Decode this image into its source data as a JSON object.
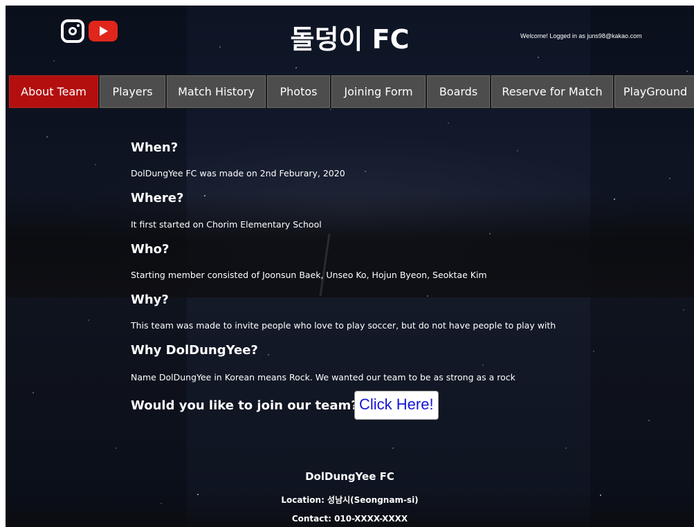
{
  "header": {
    "title": "돌덩이 FC",
    "welcome": "Welcome! Logged in as juns98@kakao.com"
  },
  "nav": [
    {
      "label": "About Team",
      "name": "nav-about-team"
    },
    {
      "label": "Players",
      "name": "nav-players"
    },
    {
      "label": "Match History",
      "name": "nav-match-history"
    },
    {
      "label": "Photos",
      "name": "nav-photos"
    },
    {
      "label": "Joining Form",
      "name": "nav-joining-form"
    },
    {
      "label": "Boards",
      "name": "nav-boards"
    },
    {
      "label": "Reserve for Match",
      "name": "nav-reserve-for-match"
    },
    {
      "label": "PlayGround",
      "name": "nav-playground"
    }
  ],
  "sections": [
    {
      "heading": "When?",
      "text": "DolDungYee FC was made on 2nd Feburary, 2020"
    },
    {
      "heading": "Where?",
      "text": "It first started on Chorim Elementary School"
    },
    {
      "heading": "Who?",
      "text": "Starting member consisted of Joonsun Baek, Unseo Ko, Hojun Byeon, Seoktae Kim"
    },
    {
      "heading": "Why?",
      "text": "This team was made to invite people who love to play soccer, but do not have people to play with"
    },
    {
      "heading": "Why DolDungYee?",
      "text": "Name DolDungYee in Korean means Rock. We wanted our team to be as strong as a rock"
    }
  ],
  "cta": {
    "question": "Would you like to join our team?",
    "button": "Click Here!"
  },
  "footer": {
    "name": "DolDungYee FC",
    "location": "Location: 성남시(Seongnam-si)",
    "contact": "Contact: 010-XXXX-XXXX"
  },
  "icons": {
    "instagram": "instagram-icon",
    "youtube": "youtube-icon"
  },
  "colors": {
    "nav_active": "#b30f0f",
    "nav_default": "#4d4d4d",
    "youtube_red": "#e0261b",
    "cta_text": "#1515d6"
  }
}
